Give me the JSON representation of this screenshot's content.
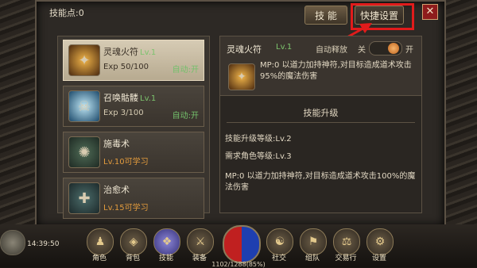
{
  "header": {
    "skill_points_label": "技能点:0",
    "tab_skill": "技 能",
    "tab_quick": "快捷设置",
    "close_glyph": "✕"
  },
  "skills": [
    {
      "name": "灵魂火符",
      "lv": "Lv.1",
      "exp": "Exp 50/100",
      "auto": "自动:开",
      "icon": "fire-talisman-icon",
      "selected": true
    },
    {
      "name": "召唤骷髅",
      "lv": "Lv.1",
      "exp": "Exp 3/100",
      "auto": "自动:开",
      "icon": "skull-icon",
      "selected": false
    },
    {
      "name": "施毒术",
      "lv": "",
      "exp": "Lv.10可学习",
      "auto": "",
      "icon": "poison-icon",
      "selected": false
    },
    {
      "name": "治愈术",
      "lv": "",
      "exp": "Lv.15可学习",
      "auto": "",
      "icon": "heal-icon",
      "selected": false
    }
  ],
  "detail": {
    "name": "灵魂火符",
    "lv": "Lv.1",
    "auto_release_label": "自动释放",
    "off_label": "关",
    "on_label": "开",
    "toggle_on": true,
    "description": "MP:0  以道力加持神符,对目标造成道术攻击95%的魔法伤害",
    "upgrade_title": "技能升级",
    "upgrade_level": "技能升级等级:Lv.2",
    "required_level": "需求角色等级:Lv.3",
    "upgrade_description": "MP:0  以道力加持神符,对目标造成道术攻击100%的魔法伤害"
  },
  "status": {
    "time": "14:39:50",
    "hp_text": "1102/1288(85%)"
  },
  "menu": [
    {
      "label": "角色",
      "icon": "character-icon"
    },
    {
      "label": "背包",
      "icon": "bag-icon"
    },
    {
      "label": "技能",
      "icon": "skill-book-icon",
      "active": true
    },
    {
      "label": "装备",
      "icon": "equipment-icon"
    },
    {
      "label": "社交",
      "icon": "social-icon"
    },
    {
      "label": "组队",
      "icon": "team-icon"
    },
    {
      "label": "交易行",
      "icon": "trade-icon"
    },
    {
      "label": "设置",
      "icon": "settings-icon"
    }
  ],
  "colors": {
    "highlight": "#e11b1b",
    "level_green": "#7cc36d",
    "learn_orange": "#e09a3d"
  }
}
